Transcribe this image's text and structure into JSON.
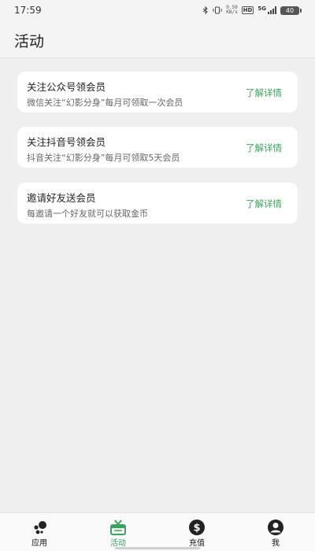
{
  "status_bar": {
    "time": "17:59",
    "net_speed_value": "0.50",
    "net_speed_unit": "KB/s",
    "hd": "HD",
    "network": "5G",
    "battery": "40"
  },
  "header": {
    "title": "活动"
  },
  "activities": [
    {
      "title": "关注公众号领会员",
      "desc": "微信关注“幻影分身”每月可领取一次会员",
      "link": "了解详情"
    },
    {
      "title": "关注抖音号领会员",
      "desc": "抖音关注“幻影分身”每月可领取5天会员",
      "link": "了解详情"
    },
    {
      "title": "邀请好友送会员",
      "desc": "每邀请一个好友就可以获取金币",
      "link": "了解详情"
    }
  ],
  "tabbar": {
    "items": [
      {
        "label": "应用",
        "icon": "apps-icon"
      },
      {
        "label": "活动",
        "icon": "gift-icon"
      },
      {
        "label": "充值",
        "icon": "dollar-icon"
      },
      {
        "label": "我",
        "icon": "user-icon"
      }
    ],
    "active_index": 1,
    "active_color": "#3aa35c"
  },
  "colors": {
    "accent": "#3aa35c",
    "background": "#efefef",
    "card": "#ffffff"
  }
}
